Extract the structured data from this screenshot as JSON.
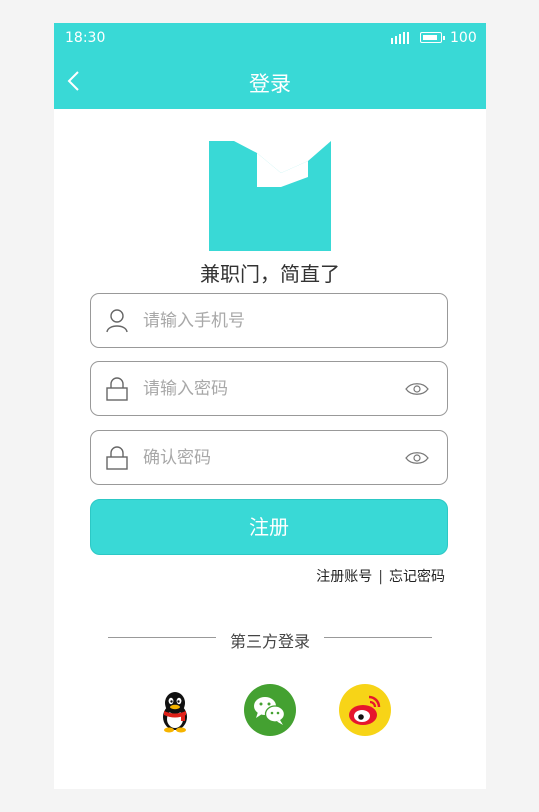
{
  "status_bar": {
    "time": "18:30",
    "battery": "100",
    "signal_icon": "signal-bars-icon",
    "battery_icon": "battery-icon"
  },
  "nav": {
    "title": "登录",
    "back_icon": "chevron-left-icon"
  },
  "brand": {
    "logo_icon": "m-logo-icon",
    "slogan": "兼职门，简直了",
    "color": "#39d9d6"
  },
  "form": {
    "phone": {
      "placeholder": "请输入手机号",
      "icon": "user-icon"
    },
    "password": {
      "placeholder": "请输入密码",
      "icon": "lock-icon",
      "toggle_icon": "eye-icon"
    },
    "confirm": {
      "placeholder": "确认密码",
      "icon": "lock-icon",
      "toggle_icon": "eye-icon"
    },
    "submit_label": "注册"
  },
  "links": {
    "register": "注册账号",
    "separator": "|",
    "forgot": "忘记密码"
  },
  "third_party": {
    "label": "第三方登录",
    "providers": [
      {
        "name": "qq-icon",
        "color": "#000000"
      },
      {
        "name": "wechat-icon",
        "color": "#44a131"
      },
      {
        "name": "weibo-icon",
        "color": "#f7d417"
      }
    ]
  }
}
